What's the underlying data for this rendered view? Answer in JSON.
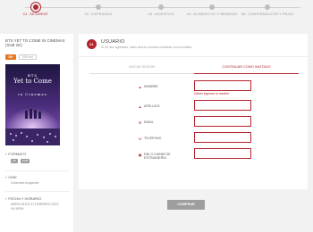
{
  "steps": [
    {
      "label": "01. SEGMENT"
    },
    {
      "label": "02. ENTRADAS"
    },
    {
      "label": "03. ASIENTOS"
    },
    {
      "label": "04. ALIMENTOS Y BEBIDAS"
    },
    {
      "label": "05. CONFIRMACIÓN Y PAGO"
    }
  ],
  "sidebar": {
    "movie_title": "BTS YET TO COME IN CINEMAS (SUB 2D)",
    "badges": [
      "18+",
      "100 min"
    ],
    "poster": {
      "line1": "BTS",
      "line2": "Yet to Come",
      "line3": "in Cinemas"
    },
    "format": {
      "heading": "FORMATO",
      "badges": [
        "2D",
        "SUB"
      ]
    },
    "cinema": {
      "heading": "CINE",
      "value": "Cinemark Angamos"
    },
    "datetime": {
      "heading": "FECHA Y HORARIO",
      "value": "MIERCOLES 01 FEBRERO 2023 09:30PM"
    }
  },
  "card": {
    "number": "01",
    "title": "USUARIO",
    "subtitle": "Si no has ingresado, hazlo ahora o puedes continuar como invitado.",
    "tabs": [
      {
        "label": "INICIAR SESIÓN"
      },
      {
        "label": "CONTINUAR COMO INVITADO"
      }
    ],
    "fields": [
      {
        "label": "NOMBRE",
        "icon": "person-icon",
        "value": "",
        "error": "Debes ingresar tu nombre"
      },
      {
        "label": "APELLIDO",
        "icon": "person-icon",
        "value": ""
      },
      {
        "label": "EMAIL",
        "icon": "envelope-icon",
        "value": ""
      },
      {
        "label": "TELÉFONO",
        "icon": "phone-icon",
        "value": ""
      },
      {
        "label": "DNI O CARNÉ DE EXTRANJERÍA",
        "icon": "id-card-icon",
        "value": ""
      }
    ]
  },
  "submit_label": "COMPRAR",
  "colors": {
    "accent": "#b3262e",
    "orange": "#e8751a",
    "disabled": "#9e9e9e"
  }
}
